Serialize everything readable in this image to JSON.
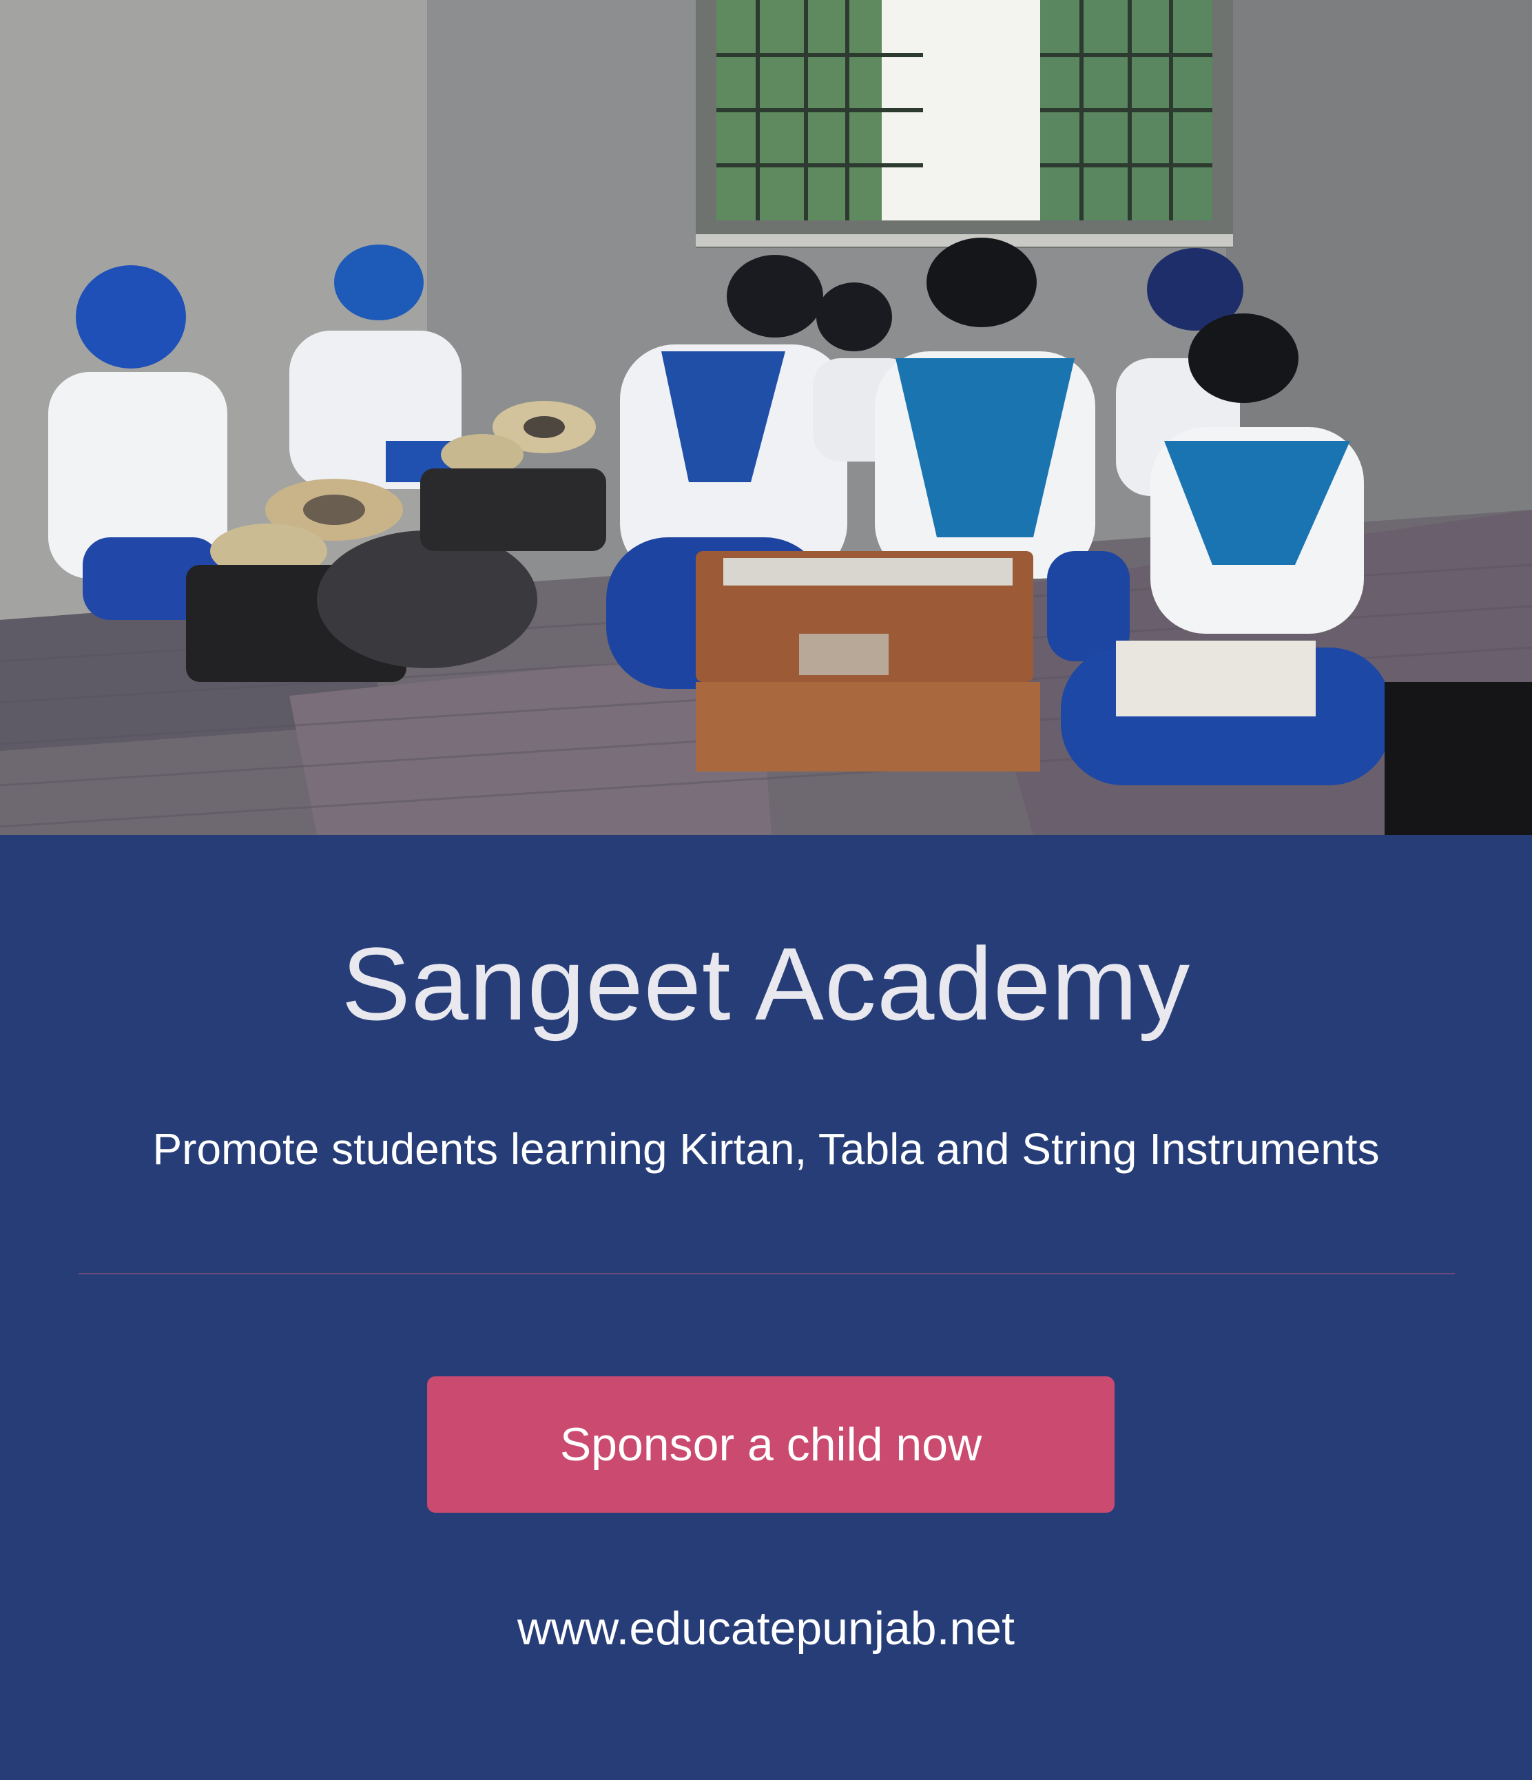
{
  "hero": {
    "image_description_alt": "Students in blue and white uniforms playing tabla and harmonium in a classroom"
  },
  "content": {
    "title": "Sangeet Academy",
    "subtitle": "Promote students learning Kirtan, Tabla and String Instruments",
    "cta_label": "Sponsor a child now",
    "website": "www.educatepunjab.net"
  },
  "colors": {
    "background": "#263d78",
    "cta": "#cb4a6f",
    "divider": "#6b4a7a",
    "title_text": "#e8e8ee"
  }
}
